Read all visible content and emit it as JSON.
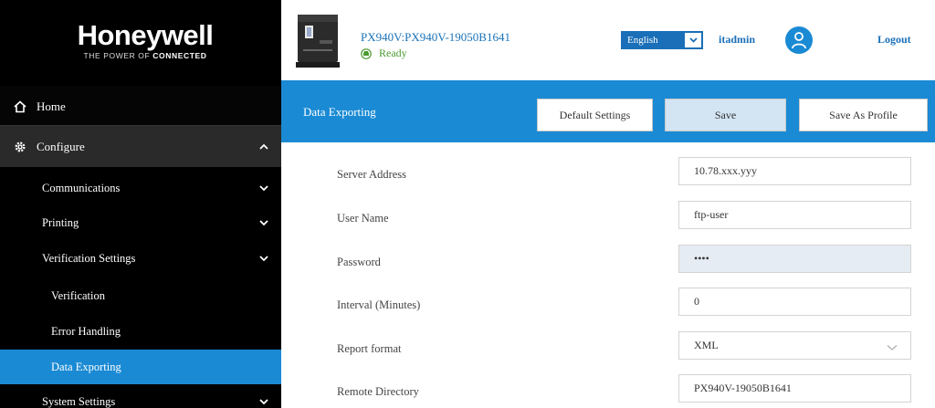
{
  "brand": {
    "name": "Honeywell",
    "tagline_prefix": "THE POWER OF ",
    "tagline_bold": "CONNECTED"
  },
  "sidebar": {
    "home": "Home",
    "configure": "Configure",
    "items": [
      {
        "label": "Communications"
      },
      {
        "label": "Printing"
      },
      {
        "label": "Verification Settings"
      },
      {
        "label": "Verification"
      },
      {
        "label": "Error Handling"
      },
      {
        "label": "Data Exporting",
        "active": true
      },
      {
        "label": "System Settings"
      }
    ]
  },
  "header": {
    "device_name": "PX940V:PX940V-19050B1641",
    "status": "Ready",
    "language": "English",
    "user": "itadmin",
    "logout": "Logout"
  },
  "toolbar": {
    "title": "Data Exporting",
    "default_settings": "Default Settings",
    "save": "Save",
    "save_as_profile": "Save As Profile"
  },
  "form": {
    "server_address": {
      "label": "Server Address",
      "value": "10.78.xxx.yyy"
    },
    "user_name": {
      "label": "User Name",
      "value": "ftp-user"
    },
    "password": {
      "label": "Password",
      "value": "••••"
    },
    "interval": {
      "label": "Interval (Minutes)",
      "value": "0"
    },
    "report_format": {
      "label": "Report format",
      "value": "XML"
    },
    "remote_directory": {
      "label": "Remote Directory",
      "value": "PX940V-19050B1641"
    }
  },
  "colors": {
    "accent": "#1a8ad4",
    "link": "#1a6fb8",
    "status_ready": "#4a9a2f",
    "sidebar_bg": "#000000"
  }
}
